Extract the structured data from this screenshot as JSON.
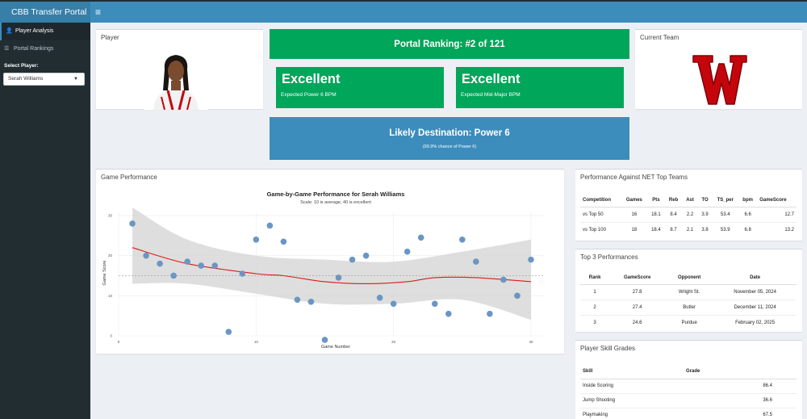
{
  "app": {
    "title": "CBB Transfer Portal"
  },
  "navbar": {
    "toggle_glyph": "≡"
  },
  "sidebar": {
    "items": [
      {
        "icon": "user-icon",
        "glyph": "👤",
        "label": "Player Analysis"
      },
      {
        "icon": "list-icon",
        "glyph": "☰",
        "label": "Portal Rankings"
      }
    ],
    "select_label": "Select Player:",
    "selected_player": "Serah Williams"
  },
  "player_box": {
    "title": "Player"
  },
  "team_box": {
    "title": "Current Team"
  },
  "ranking": {
    "text": "Portal Ranking: #2 of 121"
  },
  "power6": {
    "value": "Excellent",
    "label": "Expected Power 6 BPM"
  },
  "midmajor": {
    "value": "Excellent",
    "label": "Expected Mid-Major BPM"
  },
  "destination": {
    "title": "Likely Destination: Power 6",
    "subtitle": "(99.9% chance of Power 6)"
  },
  "game_perf": {
    "title": "Game Performance"
  },
  "chart_data": {
    "type": "scatter",
    "title": "Game-by-Game Performance for Serah Williams",
    "subtitle": "Scale: 10 is average, 40 is excellent",
    "xlabel": "Game Number",
    "ylabel": "Game Score",
    "xlim": [
      0,
      31
    ],
    "ylim": [
      0,
      31
    ],
    "xticks": [
      0,
      10,
      20,
      30
    ],
    "yticks": [
      0,
      10,
      20,
      30
    ],
    "reference_line": 15,
    "points": [
      {
        "x": 1,
        "y": 28
      },
      {
        "x": 2,
        "y": 20
      },
      {
        "x": 3,
        "y": 18
      },
      {
        "x": 4,
        "y": 15
      },
      {
        "x": 5,
        "y": 18.5
      },
      {
        "x": 6,
        "y": 17.5
      },
      {
        "x": 7,
        "y": 17.5
      },
      {
        "x": 8,
        "y": 1
      },
      {
        "x": 9,
        "y": 15.5
      },
      {
        "x": 10,
        "y": 24
      },
      {
        "x": 11,
        "y": 27.5
      },
      {
        "x": 12,
        "y": 23.5
      },
      {
        "x": 13,
        "y": 9
      },
      {
        "x": 14,
        "y": 8.5
      },
      {
        "x": 15,
        "y": -1
      },
      {
        "x": 16,
        "y": 14.5
      },
      {
        "x": 17,
        "y": 19
      },
      {
        "x": 18,
        "y": 20
      },
      {
        "x": 19,
        "y": 9.5
      },
      {
        "x": 20,
        "y": 8
      },
      {
        "x": 21,
        "y": 21
      },
      {
        "x": 22,
        "y": 24.5
      },
      {
        "x": 23,
        "y": 8
      },
      {
        "x": 24,
        "y": 5.5
      },
      {
        "x": 25,
        "y": 24
      },
      {
        "x": 26,
        "y": 18.5
      },
      {
        "x": 27,
        "y": 5.5
      },
      {
        "x": 28,
        "y": 14
      },
      {
        "x": 29,
        "y": 10
      },
      {
        "x": 30,
        "y": 19
      }
    ],
    "trend": [
      {
        "x": 1,
        "y": 22
      },
      {
        "x": 5,
        "y": 18
      },
      {
        "x": 10,
        "y": 15.5
      },
      {
        "x": 12,
        "y": 15
      },
      {
        "x": 15,
        "y": 13.5
      },
      {
        "x": 18,
        "y": 13
      },
      {
        "x": 21,
        "y": 13.5
      },
      {
        "x": 23,
        "y": 14.5
      },
      {
        "x": 26,
        "y": 14.5
      },
      {
        "x": 30,
        "y": 13.5
      }
    ],
    "band_upper": [
      {
        "x": 1,
        "y": 32
      },
      {
        "x": 5,
        "y": 24
      },
      {
        "x": 10,
        "y": 20
      },
      {
        "x": 15,
        "y": 19
      },
      {
        "x": 20,
        "y": 18.5
      },
      {
        "x": 25,
        "y": 21
      },
      {
        "x": 30,
        "y": 24
      }
    ],
    "band_lower": [
      {
        "x": 1,
        "y": 13
      },
      {
        "x": 5,
        "y": 13
      },
      {
        "x": 10,
        "y": 10.5
      },
      {
        "x": 15,
        "y": 8
      },
      {
        "x": 20,
        "y": 8
      },
      {
        "x": 25,
        "y": 9
      },
      {
        "x": 30,
        "y": 4
      }
    ],
    "colors": {
      "point": "#6b96c3",
      "trend": "#d81b1b",
      "band": "#d3d3d3",
      "refline": "#999999"
    }
  },
  "net_perf": {
    "title": "Performance Against NET Top Teams",
    "columns": [
      "Competition",
      "Games",
      "Pts",
      "Reb",
      "Ast",
      "TO",
      "TS_per",
      "bpm",
      "GameScore"
    ],
    "rows": [
      [
        "vs Top 50",
        "16",
        "18.1",
        "8.4",
        "2.2",
        "3.9",
        "53.4",
        "6.6",
        "12.7"
      ],
      [
        "vs Top 100",
        "18",
        "18.4",
        "8.7",
        "2.1",
        "3.8",
        "53.9",
        "6.8",
        "13.2"
      ]
    ]
  },
  "top3": {
    "title": "Top 3 Performances",
    "columns": [
      "Rank",
      "GameScore",
      "Opponent",
      "Date"
    ],
    "rows": [
      [
        "1",
        "27.8",
        "Wright St.",
        "November 05, 2024"
      ],
      [
        "2",
        "27.4",
        "Butler",
        "December 11, 2024"
      ],
      [
        "3",
        "24.6",
        "Purdue",
        "February 02, 2025"
      ]
    ]
  },
  "skills": {
    "title": "Player Skill Grades",
    "columns": [
      "Skill",
      "Grade"
    ],
    "rows": [
      [
        "Inside Scoring",
        "86.4"
      ],
      [
        "Jump Shooting",
        "36.6"
      ],
      [
        "Playmaking",
        "67.5"
      ]
    ]
  },
  "colors": {
    "green": "#00a65a",
    "blue": "#3c8dbc",
    "sidebar": "#222d32",
    "badger_red": "#c5050c"
  }
}
